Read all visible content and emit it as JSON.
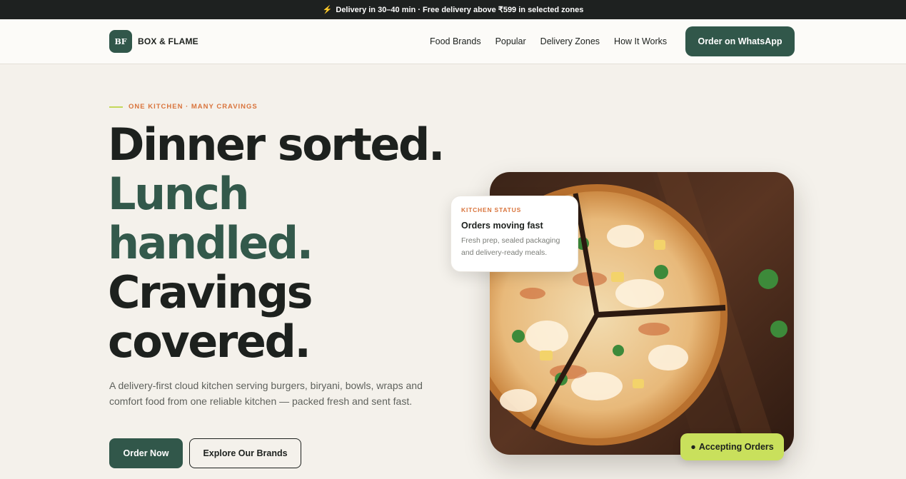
{
  "announcement": {
    "icon": "lightning-icon",
    "text": "Delivery in 30–40 min · Free delivery above ₹599 in selected zones"
  },
  "nav": {
    "logo_mark": "BF",
    "brand_name": "BOX & FLAME",
    "links": [
      "Food Brands",
      "Popular",
      "Delivery Zones",
      "How It Works"
    ],
    "cta": "Order on WhatsApp"
  },
  "hero": {
    "eyebrow": "ONE KITCHEN · MANY CRAVINGS",
    "headline": {
      "line1": "Dinner sorted.",
      "line2": "Lunch",
      "line3": "handled.",
      "line4": "Cravings",
      "line5": "covered."
    },
    "lead": "A delivery-first cloud kitchen serving burgers, biryani, bowls, wraps and comfort food from one reliable kitchen — packed fresh and sent fast.",
    "primary_button": "Order Now",
    "secondary_button": "Explore Our Brands"
  },
  "status_card": {
    "label": "KITCHEN STATUS",
    "title": "Orders moving fast",
    "description": "Fresh prep, sealed packaging and delivery-ready meals."
  },
  "badge": {
    "bullet": "●",
    "text": "Accepting Orders"
  },
  "colors": {
    "brand_green": "#31574a",
    "accent_orange": "#d9743c",
    "accent_lime": "#c9e05c",
    "dark": "#1e2120",
    "background": "#f4f1eb"
  }
}
